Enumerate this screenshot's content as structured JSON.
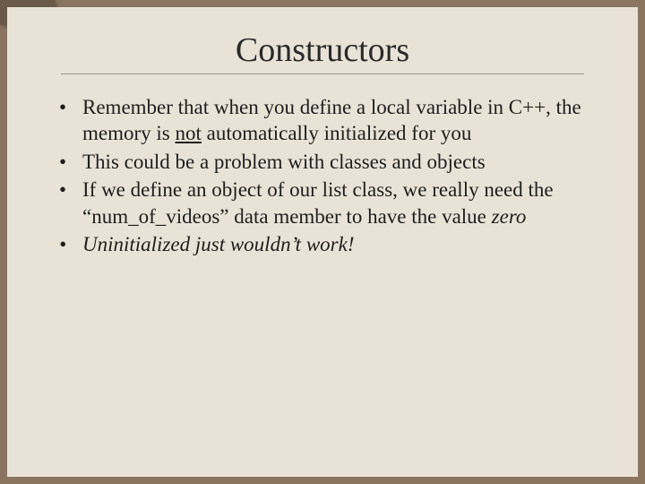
{
  "slide": {
    "title": "Constructors",
    "bullets": [
      {
        "pre": "Remember that when you define a local variable in C++, the memory is ",
        "underlined": "not",
        "post": " automatically initialized for you",
        "italic": false
      },
      {
        "pre": "This could be a problem with classes and objects",
        "underlined": "",
        "post": "",
        "italic": false
      },
      {
        "pre": "If we define an object of our list class, we really need the “num_of_videos” data member to have the value ",
        "underlined": "",
        "post": "",
        "italic_tail": "zero",
        "italic": false
      },
      {
        "pre": "Uninitialized just wouldn’t work!",
        "underlined": "",
        "post": "",
        "italic": true
      }
    ]
  }
}
